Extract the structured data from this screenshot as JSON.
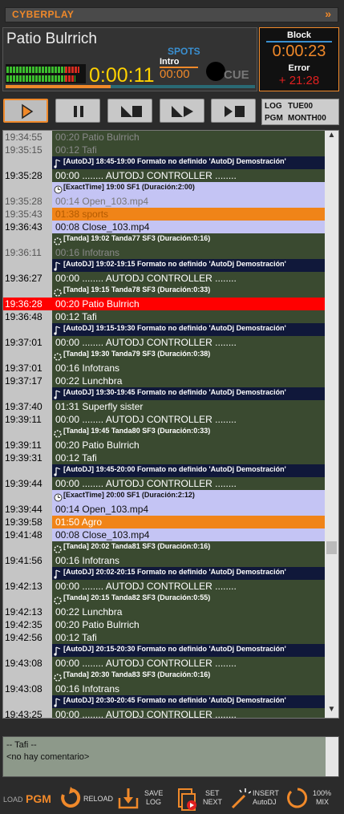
{
  "app": {
    "title": "CYBERPLAY",
    "collapse_icon": "double-chevron-right"
  },
  "now_playing": {
    "title": "Patio Bulrrich",
    "elapsed": "0:00:11",
    "spots_label": "SPOTS",
    "intro_label": "Intro",
    "intro_value": "00:00",
    "cue_label": "CUE",
    "progress": 0.42
  },
  "block_panel": {
    "block_label": "Block",
    "block_value": "0:00:23",
    "error_label": "Error",
    "error_value": "+ 21:28"
  },
  "controls": [
    "play",
    "pause",
    "stop-at-end",
    "play-next",
    "stop"
  ],
  "log_pgm": {
    "log_label": "LOG",
    "log_value": "TUE00",
    "pgm_label": "PGM",
    "pgm_value": "MONTH00"
  },
  "colors": {
    "accent": "#f0892a",
    "sep": "#10183a",
    "item_dark": "#3a4a30",
    "exacttime": "#c4c4f4",
    "spot": "#f08418",
    "current": "#ff0000",
    "past": "#555555"
  },
  "playlist": [
    {
      "type": "item",
      "time": "19:34:55",
      "text": "00:20 Patio Bulrrich",
      "style": "past"
    },
    {
      "type": "item",
      "time": "19:35:15",
      "text": "00:12 Tafi",
      "style": "past"
    },
    {
      "type": "sep",
      "icon": "autodj",
      "time": "",
      "text": "[AutoDJ] 18:45-19:00 Formato no definido 'AutoDj Demostración'"
    },
    {
      "type": "item",
      "time": "19:35:28",
      "text": "00:00 ........ AUTODJ CONTROLLER ........",
      "style": "normal"
    },
    {
      "type": "sep",
      "icon": "clock",
      "time": "",
      "text": "[ExactTime] 19:00   SF1 (Duración:2:00)",
      "style": "exact"
    },
    {
      "type": "item",
      "time": "19:35:28",
      "text": "00:14 Open_103.mp4",
      "style": "exact_past"
    },
    {
      "type": "item",
      "time": "19:35:43",
      "text": "01:38 sports",
      "style": "spot_past"
    },
    {
      "type": "item",
      "time": "19:36:43",
      "text": "00:08 Close_103.mp4",
      "style": "exact"
    },
    {
      "type": "sep",
      "icon": "tanda",
      "time": "",
      "text": "[Tanda] 19:02 Tanda77   SF3 (Duración:0:16)",
      "style": "tanda"
    },
    {
      "type": "item",
      "time": "19:36:11",
      "text": "00:16 Infotrans",
      "style": "past"
    },
    {
      "type": "sep",
      "icon": "autodj",
      "time": "",
      "text": "[AutoDJ] 19:02-19:15 Formato no definido 'AutoDj Demostración'"
    },
    {
      "type": "item",
      "time": "19:36:27",
      "text": "00:00 ........ AUTODJ CONTROLLER ........",
      "style": "normal"
    },
    {
      "type": "sep",
      "icon": "tanda",
      "time": "",
      "text": "[Tanda] 19:15 Tanda78   SF3 (Duración:0:33)",
      "style": "tanda"
    },
    {
      "type": "item",
      "time": "19:36:28",
      "text": "00:20 Patio Bulrrich",
      "style": "current"
    },
    {
      "type": "item",
      "time": "19:36:48",
      "text": "00:12 Tafi",
      "style": "normal"
    },
    {
      "type": "sep",
      "icon": "autodj",
      "time": "",
      "text": "[AutoDJ] 19:15-19:30 Formato no definido 'AutoDj Demostración'"
    },
    {
      "type": "item",
      "time": "19:37:01",
      "text": "00:00 ........ AUTODJ CONTROLLER ........",
      "style": "normal"
    },
    {
      "type": "sep",
      "icon": "tanda",
      "time": "",
      "text": "[Tanda] 19:30 Tanda79   SF3 (Duración:0:38)",
      "style": "tanda"
    },
    {
      "type": "item",
      "time": "19:37:01",
      "text": "00:16 Infotrans",
      "style": "normal"
    },
    {
      "type": "item",
      "time": "19:37:17",
      "text": "00:22 Lunchbra",
      "style": "normal"
    },
    {
      "type": "sep",
      "icon": "autodj",
      "time": "",
      "text": "[AutoDJ] 19:30-19:45 Formato no definido 'AutoDj Demostración'"
    },
    {
      "type": "item",
      "time": "19:37:40",
      "text": "01:31 Superfly sister",
      "style": "normal"
    },
    {
      "type": "item",
      "time": "19:39:11",
      "text": "00:00 ........ AUTODJ CONTROLLER ........",
      "style": "normal"
    },
    {
      "type": "sep",
      "icon": "tanda",
      "time": "",
      "text": "[Tanda] 19:45 Tanda80   SF3 (Duración:0:33)",
      "style": "tanda"
    },
    {
      "type": "item",
      "time": "19:39:11",
      "text": "00:20 Patio Bulrrich",
      "style": "normal"
    },
    {
      "type": "item",
      "time": "19:39:31",
      "text": "00:12 Tafi",
      "style": "normal"
    },
    {
      "type": "sep",
      "icon": "autodj",
      "time": "",
      "text": "[AutoDJ] 19:45-20:00 Formato no definido 'AutoDj Demostración'"
    },
    {
      "type": "item",
      "time": "19:39:44",
      "text": "00:00 ........ AUTODJ CONTROLLER ........",
      "style": "normal"
    },
    {
      "type": "sep",
      "icon": "clock",
      "time": "",
      "text": "[ExactTime] 20:00   SF1 (Duración:2:12)",
      "style": "exact"
    },
    {
      "type": "item",
      "time": "19:39:44",
      "text": "00:14 Open_103.mp4",
      "style": "exact"
    },
    {
      "type": "item",
      "time": "19:39:58",
      "text": "01:50 Agro",
      "style": "spot"
    },
    {
      "type": "item",
      "time": "19:41:48",
      "text": "00:08 Close_103.mp4",
      "style": "exact"
    },
    {
      "type": "sep",
      "icon": "tanda",
      "time": "",
      "text": "[Tanda] 20:02 Tanda81   SF3 (Duración:0:16)",
      "style": "tanda"
    },
    {
      "type": "item",
      "time": "19:41:56",
      "text": "00:16 Infotrans",
      "style": "normal"
    },
    {
      "type": "sep",
      "icon": "autodj",
      "time": "",
      "text": "[AutoDJ] 20:02-20:15 Formato no definido 'AutoDj Demostración'"
    },
    {
      "type": "item",
      "time": "19:42:13",
      "text": "00:00 ........ AUTODJ CONTROLLER ........",
      "style": "normal"
    },
    {
      "type": "sep",
      "icon": "tanda",
      "time": "",
      "text": "[Tanda] 20:15 Tanda82   SF3 (Duración:0:55)",
      "style": "tanda"
    },
    {
      "type": "item",
      "time": "19:42:13",
      "text": "00:22 Lunchbra",
      "style": "normal"
    },
    {
      "type": "item",
      "time": "19:42:35",
      "text": "00:20 Patio Bulrrich",
      "style": "normal"
    },
    {
      "type": "item",
      "time": "19:42:56",
      "text": "00:12 Tafi",
      "style": "normal"
    },
    {
      "type": "sep",
      "icon": "autodj",
      "time": "",
      "text": "[AutoDJ] 20:15-20:30 Formato no definido 'AutoDj Demostración'"
    },
    {
      "type": "item",
      "time": "19:43:08",
      "text": "00:00 ........ AUTODJ CONTROLLER ........",
      "style": "normal"
    },
    {
      "type": "sep",
      "icon": "tanda",
      "time": "",
      "text": "[Tanda] 20:30 Tanda83   SF3 (Duración:0:16)",
      "style": "tanda"
    },
    {
      "type": "item",
      "time": "19:43:08",
      "text": "00:16 Infotrans",
      "style": "normal"
    },
    {
      "type": "sep",
      "icon": "autodj",
      "time": "",
      "text": "[AutoDJ] 20:30-20:45 Formato no definido 'AutoDj Demostración'"
    },
    {
      "type": "item",
      "time": "19:43:25",
      "text": "00:00 ........ AUTODJ CONTROLLER ........",
      "style": "normal"
    }
  ],
  "comment": {
    "line1": "-- Tafi --",
    "line2": "<no hay comentario>"
  },
  "bottom": {
    "load_label": "LOAD",
    "load_value": "PGM",
    "reload": "RELOAD",
    "save_log": [
      "SAVE",
      "LOG"
    ],
    "set_next": [
      "SET",
      "NEXT"
    ],
    "insert_autodj": [
      "INSERT",
      "AutoDJ"
    ],
    "mix": [
      "100%",
      "MIX"
    ]
  }
}
